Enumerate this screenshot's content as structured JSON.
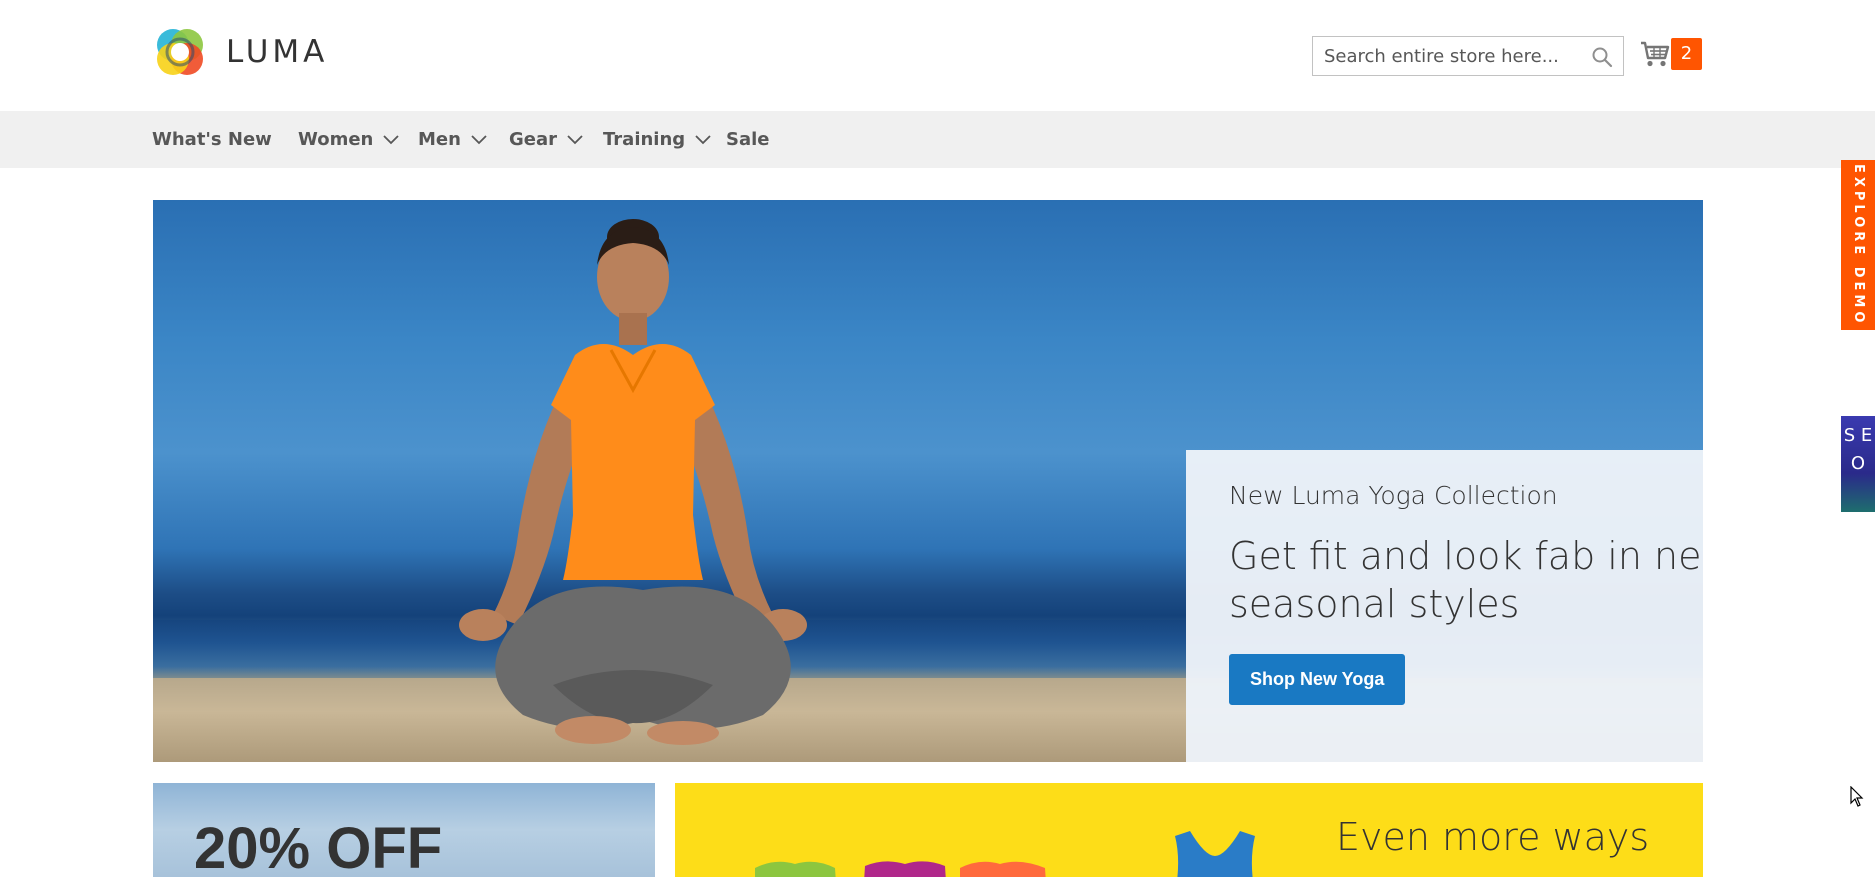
{
  "brand": {
    "name": "LUMA"
  },
  "search": {
    "placeholder": "Search entire store here..."
  },
  "cart": {
    "count": "2"
  },
  "nav": {
    "items": [
      {
        "label": "What's New"
      },
      {
        "label": "Women"
      },
      {
        "label": "Men"
      },
      {
        "label": "Gear"
      },
      {
        "label": "Training"
      },
      {
        "label": "Sale"
      }
    ]
  },
  "hero": {
    "subtitle": "New Luma Yoga Collection",
    "title": "Get fit and look fab in new seasonal styles",
    "button": "Shop New Yoga"
  },
  "promos": {
    "left": "20% OFF",
    "right": "Even more ways"
  },
  "side_tabs": {
    "explore": "EXPLORE DEMO",
    "seo": "S E O"
  },
  "colors": {
    "accent_orange": "#ff5501",
    "button_blue": "#1979c3",
    "nav_bg": "#f0f0f0",
    "banner_yellow": "#fddd18"
  },
  "icons": [
    "luma-logo-icon",
    "search-icon",
    "cart-icon",
    "chevron-down-icon",
    "cursor-icon"
  ]
}
